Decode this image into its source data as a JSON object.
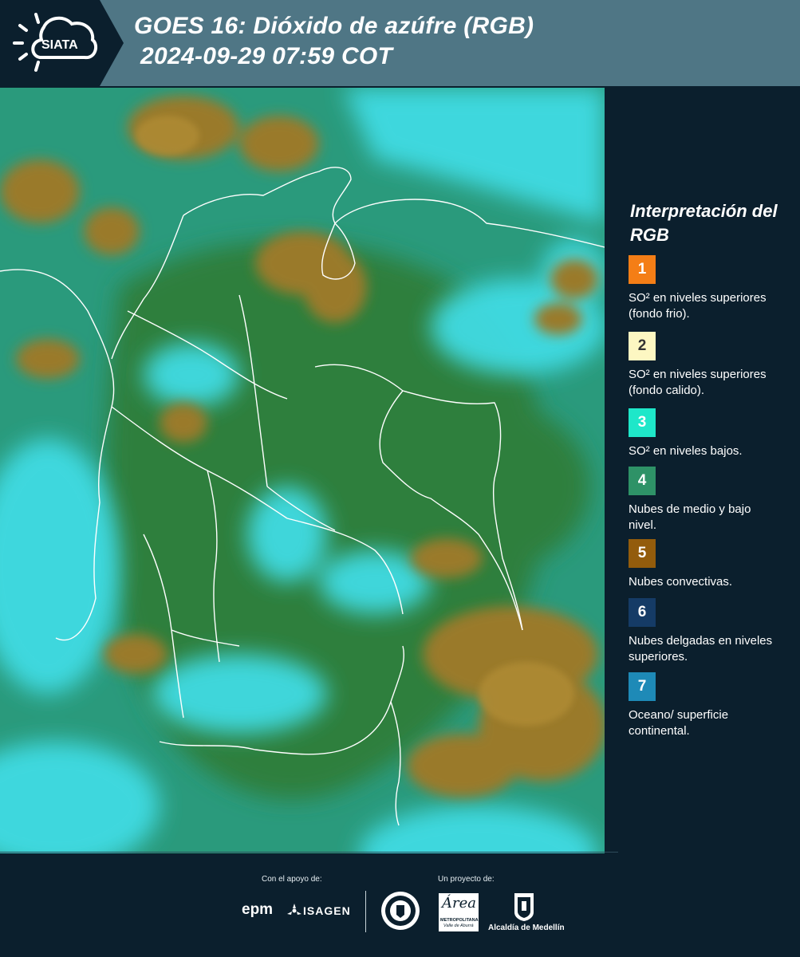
{
  "header": {
    "logo_text": "SIATA",
    "title_line1": "GOES 16: Dióxido de azúfre (RGB)",
    "title_line2": "2024-09-29 07:59 COT"
  },
  "legend": {
    "title": "Interpretación del RGB",
    "items": [
      {
        "number": "1",
        "color": "#f47e16",
        "text_color": "#ffffff",
        "desc": "SO² en niveles superiores (fondo frio)."
      },
      {
        "number": "2",
        "color": "#fdf7c2",
        "text_color": "#333333",
        "desc": "SO² en niveles superiores (fondo calido)."
      },
      {
        "number": "3",
        "color": "#1ee7c9",
        "text_color": "#ffffff",
        "desc": "SO² en niveles bajos."
      },
      {
        "number": "4",
        "color": "#2e9267",
        "text_color": "#ffffff",
        "desc": "Nubes de medio y bajo nivel."
      },
      {
        "number": "5",
        "color": "#935c0c",
        "text_color": "#ffffff",
        "desc": "Nubes convectivas."
      },
      {
        "number": "6",
        "color": "#153b66",
        "text_color": "#ffffff",
        "desc": "Nubes delgadas en niveles superiores."
      },
      {
        "number": "7",
        "color": "#1e8ab7",
        "text_color": "#ffffff",
        "desc": "Oceano/ superficie continental."
      }
    ]
  },
  "footer": {
    "support_label": "Con el apoyo de:",
    "project_label": "Un proyecto de:",
    "sponsor_1": "epm",
    "sponsor_2": "ISAGEN",
    "partner_area": "Área",
    "partner_area_sub1": "METROPOLITANA",
    "partner_area_sub2": "Valle de Aburrá",
    "partner_alcaldia": "Alcaldía de Medellín"
  },
  "colors": {
    "header_bg": "#4f7685",
    "page_bg": "#0b1f2d",
    "map_cyan": "#3ad6e0",
    "map_green": "#2b8a55",
    "map_brown": "#9a7a2a"
  }
}
